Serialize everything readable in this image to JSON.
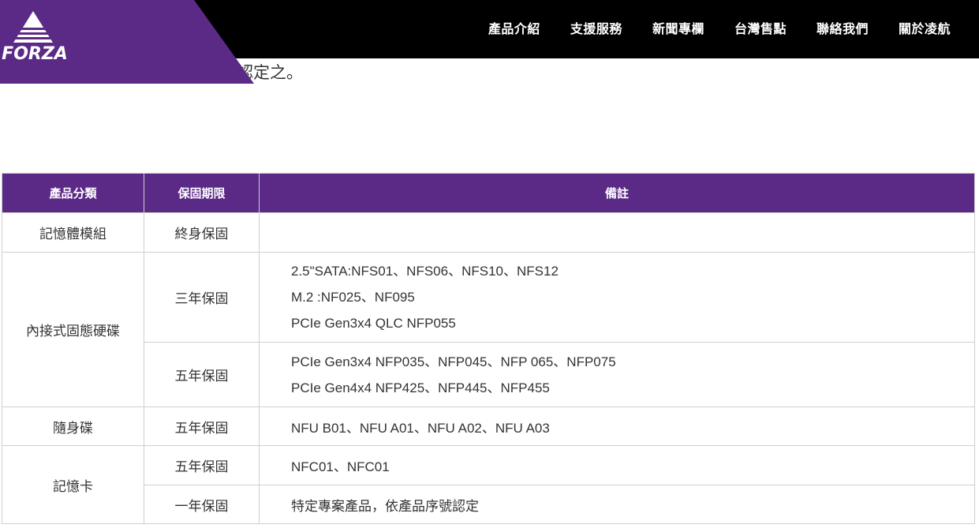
{
  "brand": {
    "name": "FORZA",
    "color": "#5b2a86"
  },
  "nav": {
    "items": [
      "產品介紹",
      "支援服務",
      "新聞專欄",
      "台灣售點",
      "聯絡我們",
      "關於凌航"
    ]
  },
  "intro": {
    "text": "認定之。"
  },
  "table": {
    "headers": [
      "產品分類",
      "保固期限",
      "備註"
    ],
    "row_memory": {
      "category": "記憶體模組",
      "warranty": "終身保固",
      "note": ""
    },
    "ssd": {
      "category": "內接式固態硬碟",
      "sub1": {
        "warranty": "三年保固",
        "notes": [
          "2.5\"SATA:NFS01、NFS06、NFS10、NFS12",
          "M.2 :NF025、NF095",
          "PCIe Gen3x4 QLC NFP055"
        ]
      },
      "sub2": {
        "warranty": "五年保固",
        "notes": [
          "PCIe Gen3x4 NFP035、NFP045、NFP 065、NFP075",
          "PCIe Gen4x4 NFP425、NFP445、NFP455"
        ]
      }
    },
    "usb": {
      "category": "隨身碟",
      "warranty": "五年保固",
      "note": "NFU B01、NFU A01、NFU A02、NFU A03"
    },
    "card": {
      "category": "記憶卡",
      "sub1": {
        "warranty": "五年保固",
        "note": "NFC01、NFC01"
      },
      "sub2": {
        "warranty": "一年保固",
        "note": "特定專案產品，依產品序號認定"
      }
    }
  }
}
